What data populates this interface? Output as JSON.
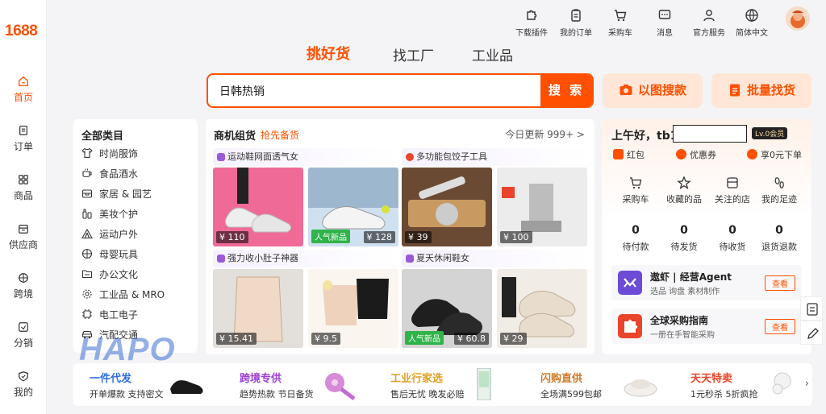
{
  "brand": {
    "logo": "1688",
    "accent": "#ff5000"
  },
  "left_nav": [
    {
      "label": "首页",
      "icon": "home-icon",
      "active": true
    },
    {
      "label": "订单",
      "icon": "order-icon"
    },
    {
      "label": "商品",
      "icon": "grid-icon"
    },
    {
      "label": "供应商",
      "icon": "shop-icon"
    },
    {
      "label": "跨境",
      "icon": "globe-icon"
    },
    {
      "label": "分销",
      "icon": "distribute-icon"
    },
    {
      "label": "我的",
      "icon": "shield-user-icon"
    }
  ],
  "topbar": [
    {
      "label": "下载插件",
      "icon": "puzzle-icon"
    },
    {
      "label": "我的订单",
      "icon": "clipboard-icon"
    },
    {
      "label": "采购车",
      "icon": "cart-icon"
    },
    {
      "label": "消息",
      "icon": "message-icon"
    },
    {
      "label": "官方服务",
      "icon": "user-icon"
    },
    {
      "label": "简体中文",
      "icon": "globe-icon"
    }
  ],
  "main_tabs": [
    {
      "label": "挑好货",
      "active": true
    },
    {
      "label": "找工厂"
    },
    {
      "label": "工业品"
    }
  ],
  "search": {
    "value": "日韩热销",
    "button": "搜 索"
  },
  "image_search": "以图搜款",
  "bulk_search": "批量找货",
  "categories": {
    "title": "全部类目",
    "items": [
      {
        "label": "时尚服饰",
        "icon": "shirt-icon"
      },
      {
        "label": "食品酒水",
        "icon": "cup-icon"
      },
      {
        "label": "家居 & 园艺",
        "icon": "box-icon"
      },
      {
        "label": "美妆个护",
        "icon": "bottle-icon"
      },
      {
        "label": "运动户外",
        "icon": "tent-icon"
      },
      {
        "label": "母婴玩具",
        "icon": "ball-icon"
      },
      {
        "label": "办公文化",
        "icon": "folder-icon"
      },
      {
        "label": "工业品 & MRO",
        "icon": "gear-icon"
      },
      {
        "label": "电工电子",
        "icon": "chip-icon"
      },
      {
        "label": "汽配交通",
        "icon": "car-icon"
      }
    ]
  },
  "deals": {
    "title": "商机组货",
    "subtitle": "抢先备货",
    "update": "今日更新 999+ >",
    "groups": [
      {
        "title": "运动鞋网面透气女",
        "dot_color": "#9b59d6",
        "products": [
          {
            "price": "¥ 110"
          },
          {
            "price": "¥ 128",
            "tag": "人气新品"
          }
        ]
      },
      {
        "title": "多功能包饺子工具",
        "dot_color": "#e8452c",
        "products": [
          {
            "price": "¥ 39"
          },
          {
            "price": "¥ 100"
          }
        ]
      },
      {
        "title": "强力收小肚子神器",
        "dot_color": "#9b59d6",
        "products": [
          {
            "price": "¥ 15.41"
          },
          {
            "price": "¥ 9.5"
          }
        ]
      },
      {
        "title": "夏天休闲鞋女",
        "dot_color": "#9b59d6",
        "products": [
          {
            "price": "¥ 60.8",
            "tag": "人气新品"
          },
          {
            "price": "¥ 29"
          }
        ]
      }
    ]
  },
  "user": {
    "greeting": "上午好，tb1",
    "level": "Lv.0会员",
    "perks": [
      "红包",
      "优惠券",
      "享0元下单"
    ],
    "shortcuts": [
      {
        "label": "采购车",
        "icon": "cart-icon"
      },
      {
        "label": "收藏的品",
        "icon": "star-icon"
      },
      {
        "label": "关注的店",
        "icon": "store-icon"
      },
      {
        "label": "我的足迹",
        "icon": "footprint-icon"
      }
    ],
    "stats": [
      {
        "num": "0",
        "label": "待付款"
      },
      {
        "num": "0",
        "label": "待发货"
      },
      {
        "num": "0",
        "label": "待收货"
      },
      {
        "num": "0",
        "label": "退货退款"
      }
    ],
    "promos": [
      {
        "title": "遨虾 | 经营Agent",
        "sub": "选品 询盘 素材制作",
        "btn": "查看",
        "color": "#6c4bd6"
      },
      {
        "title": "全球采购指南",
        "sub": "一册在手智能采购",
        "btn": "查看",
        "color": "#e8452c"
      }
    ]
  },
  "bottom_bar": [
    {
      "title": "一件代发",
      "sub": "开单爆款 支持密文",
      "color": "#2f6fe0"
    },
    {
      "title": "跨境专供",
      "sub": "趋势热款 节日备货",
      "color": "#9b3fd6"
    },
    {
      "title": "工业行家选",
      "sub": "售后无忧 晚发必赔",
      "color": "#e0a020"
    },
    {
      "title": "闪购直供",
      "sub": "全场满599包邮",
      "color": "#c87a2a"
    },
    {
      "title": "天天特卖",
      "sub": "1元秒杀 5折疯抢",
      "color": "#e8452c"
    }
  ],
  "watermark": "HAPO"
}
